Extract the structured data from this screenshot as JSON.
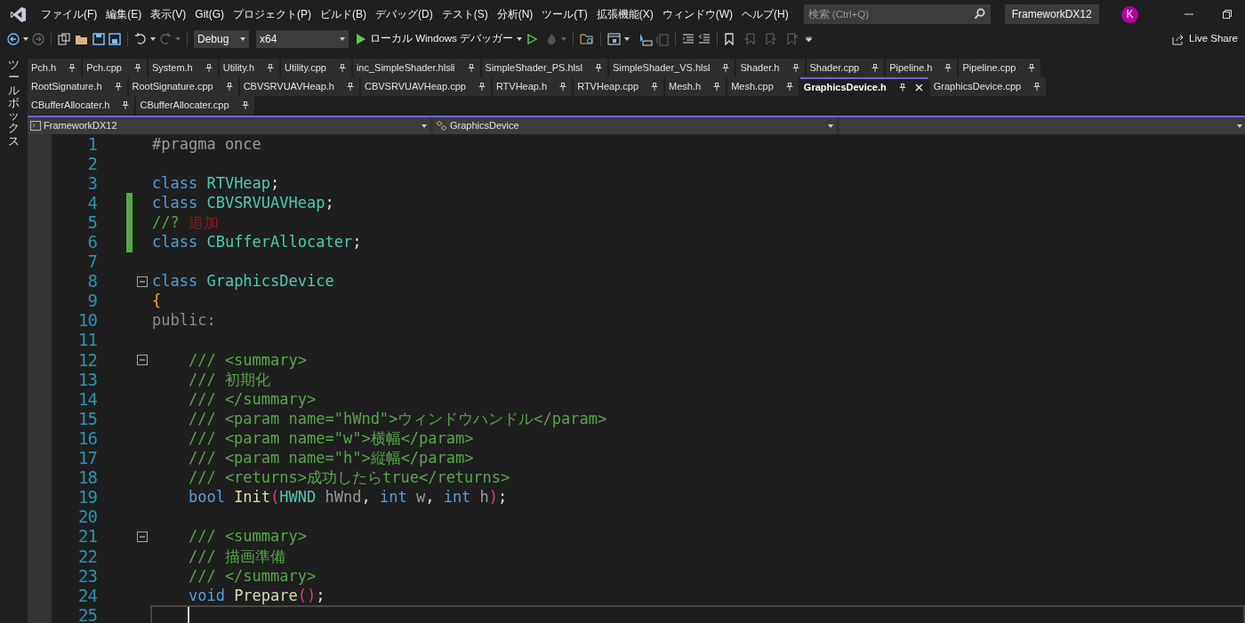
{
  "menu": [
    "ファイル(F)",
    "編集(E)",
    "表示(V)",
    "Git(G)",
    "プロジェクト(P)",
    "ビルド(B)",
    "デバッグ(D)",
    "テスト(S)",
    "分析(N)",
    "ツール(T)",
    "拡張機能(X)",
    "ウィンドウ(W)",
    "ヘルプ(H)"
  ],
  "search": {
    "placeholder": "検索 (Ctrl+Q)"
  },
  "solution_name": "FrameworkDX12",
  "avatar": "K",
  "toolbar": {
    "configuration": "Debug",
    "platform": "x64",
    "run_target": "ローカル Windows デバッガー",
    "live_share": "Live Share"
  },
  "toolbox_label": "ツールボックス",
  "tab_rows": [
    [
      {
        "label": "Pch.h",
        "selected": false
      },
      {
        "label": "Pch.cpp",
        "selected": false
      },
      {
        "label": "System.h",
        "selected": false
      },
      {
        "label": "Utility.h",
        "selected": false
      },
      {
        "label": "Utility.cpp",
        "selected": false
      },
      {
        "label": "inc_SimpleShader.hlsli",
        "selected": false
      },
      {
        "label": "SimpleShader_PS.hlsl",
        "selected": false
      },
      {
        "label": "SimpleShader_VS.hlsl",
        "selected": false
      },
      {
        "label": "Shader.h",
        "selected": false
      },
      {
        "label": "Shader.cpp",
        "selected": false
      },
      {
        "label": "Pipeline.h",
        "selected": false
      },
      {
        "label": "Pipeline.cpp",
        "selected": false
      }
    ],
    [
      {
        "label": "RootSignature.h",
        "selected": false
      },
      {
        "label": "RootSignature.cpp",
        "selected": false
      },
      {
        "label": "CBVSRVUAVHeap.h",
        "selected": false
      },
      {
        "label": "CBVSRVUAVHeap.cpp",
        "selected": false
      },
      {
        "label": "RTVHeap.h",
        "selected": false
      },
      {
        "label": "RTVHeap.cpp",
        "selected": false
      },
      {
        "label": "Mesh.h",
        "selected": false
      },
      {
        "label": "Mesh.cpp",
        "selected": false
      },
      {
        "label": "GraphicsDevice.h",
        "selected": true
      },
      {
        "label": "GraphicsDevice.cpp",
        "selected": false
      }
    ],
    [
      {
        "label": "CBufferAllocater.h",
        "selected": false
      },
      {
        "label": "CBufferAllocater.cpp",
        "selected": false
      }
    ]
  ],
  "nav_bar": {
    "project": "FrameworkDX12",
    "scope": "GraphicsDevice"
  },
  "code_lines": [
    {
      "number": "1",
      "changed": false,
      "fold": false,
      "current": false,
      "tokens": [
        {
          "kind": "pre",
          "text": "#pragma once"
        }
      ]
    },
    {
      "number": "2",
      "changed": false,
      "fold": false,
      "current": false
    },
    {
      "number": "3",
      "changed": false,
      "fold": false,
      "current": false,
      "tokens": [
        {
          "kind": "kw",
          "text": "class"
        },
        {
          "kind": "type",
          "text": " RTVHeap"
        },
        {
          "kind": "plain",
          "text": ";"
        }
      ]
    },
    {
      "number": "4",
      "changed": true,
      "fold": false,
      "current": false,
      "tokens": [
        {
          "kind": "kw",
          "text": "class"
        },
        {
          "kind": "type",
          "text": " CBVSRVUAVHeap"
        },
        {
          "kind": "plain",
          "text": ";"
        }
      ]
    },
    {
      "number": "5",
      "changed": true,
      "fold": false,
      "current": false,
      "tokens": [
        {
          "kind": "comment",
          "text": "//? "
        },
        {
          "kind": "error",
          "text": "追加"
        }
      ]
    },
    {
      "number": "6",
      "changed": true,
      "fold": false,
      "current": false,
      "tokens": [
        {
          "kind": "kw",
          "text": "class"
        },
        {
          "kind": "type",
          "text": " CBufferAllocater"
        },
        {
          "kind": "plain",
          "text": ";"
        }
      ]
    },
    {
      "number": "7",
      "changed": false,
      "fold": false,
      "current": false
    },
    {
      "number": "8",
      "changed": false,
      "fold": true,
      "current": false,
      "tokens": [
        {
          "kind": "kw",
          "text": "class"
        },
        {
          "kind": "type",
          "text": " GraphicsDevice"
        }
      ]
    },
    {
      "number": "9",
      "changed": false,
      "fold": false,
      "current": false,
      "tokens": [
        {
          "kind": "brace",
          "text": "{"
        }
      ]
    },
    {
      "number": "10",
      "changed": false,
      "fold": false,
      "current": false,
      "tokens": [
        {
          "kind": "dim",
          "text": "public:"
        }
      ]
    },
    {
      "number": "11",
      "changed": false,
      "fold": false,
      "current": false
    },
    {
      "number": "12",
      "changed": false,
      "fold": true,
      "current": false,
      "tokens": [
        {
          "kind": "comment",
          "text": "    /// <summary>"
        }
      ]
    },
    {
      "number": "13",
      "changed": false,
      "fold": false,
      "current": false,
      "tokens": [
        {
          "kind": "comment",
          "text": "    /// 初期化"
        }
      ]
    },
    {
      "number": "14",
      "changed": false,
      "fold": false,
      "current": false,
      "tokens": [
        {
          "kind": "comment",
          "text": "    /// </summary>"
        }
      ]
    },
    {
      "number": "15",
      "changed": false,
      "fold": false,
      "current": false,
      "tokens": [
        {
          "kind": "comment",
          "text": "    /// <param name=\"hWnd\">ウィンドウハンドル</param>"
        }
      ]
    },
    {
      "number": "16",
      "changed": false,
      "fold": false,
      "current": false,
      "tokens": [
        {
          "kind": "comment",
          "text": "    /// <param name=\"w\">横幅</param>"
        }
      ]
    },
    {
      "number": "17",
      "changed": false,
      "fold": false,
      "current": false,
      "tokens": [
        {
          "kind": "comment",
          "text": "    /// <param name=\"h\">縦幅</param>"
        }
      ]
    },
    {
      "number": "18",
      "changed": false,
      "fold": false,
      "current": false,
      "tokens": [
        {
          "kind": "comment",
          "text": "    /// <returns>成功したらtrue</returns>"
        }
      ]
    },
    {
      "number": "19",
      "changed": false,
      "fold": false,
      "current": false,
      "tokens": [
        {
          "kind": "kw",
          "text": "    bool"
        },
        {
          "kind": "func",
          "text": " Init"
        },
        {
          "kind": "paren",
          "text": "("
        },
        {
          "kind": "type",
          "text": "HWND"
        },
        {
          "kind": "param",
          "text": " hWnd"
        },
        {
          "kind": "plain",
          "text": ", "
        },
        {
          "kind": "kw",
          "text": "int"
        },
        {
          "kind": "param",
          "text": " w"
        },
        {
          "kind": "plain",
          "text": ", "
        },
        {
          "kind": "kw",
          "text": "int"
        },
        {
          "kind": "param",
          "text": " h"
        },
        {
          "kind": "paren",
          "text": ")"
        },
        {
          "kind": "plain",
          "text": ";"
        }
      ]
    },
    {
      "number": "20",
      "changed": false,
      "fold": false,
      "current": false
    },
    {
      "number": "21",
      "changed": false,
      "fold": true,
      "current": false,
      "tokens": [
        {
          "kind": "comment",
          "text": "    /// <summary>"
        }
      ]
    },
    {
      "number": "22",
      "changed": false,
      "fold": false,
      "current": false,
      "tokens": [
        {
          "kind": "comment",
          "text": "    /// 描画準備"
        }
      ]
    },
    {
      "number": "23",
      "changed": false,
      "fold": false,
      "current": false,
      "tokens": [
        {
          "kind": "comment",
          "text": "    /// </summary>"
        }
      ]
    },
    {
      "number": "24",
      "changed": false,
      "fold": false,
      "current": false,
      "tokens": [
        {
          "kind": "kw",
          "text": "    void"
        },
        {
          "kind": "func",
          "text": " Prepare"
        },
        {
          "kind": "paren",
          "text": "()"
        },
        {
          "kind": "plain",
          "text": ";"
        }
      ]
    },
    {
      "number": "25",
      "changed": false,
      "fold": false,
      "current": true
    }
  ]
}
